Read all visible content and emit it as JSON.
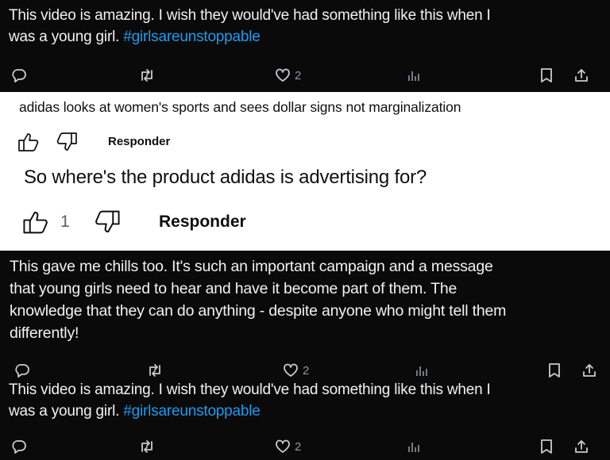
{
  "tweet1": {
    "line1": "This video is amazing. I wish they would've had something like this when I",
    "line2_prefix": "was a young girl. ",
    "hashtag": "#girlsareunstoppable",
    "likes": "2"
  },
  "comment1": {
    "text": "adidas looks at women's sports and sees dollar signs not marginalization",
    "reply_label": "Responder"
  },
  "comment2": {
    "text": "So where's the product adidas is advertising for?",
    "likes": "1",
    "reply_label": "Responder"
  },
  "tweet2": {
    "lines": [
      "This gave me chills too. It's such an important campaign and a message",
      "that young girls need to hear and have it become part of them. The",
      "knowledge that they can do anything - despite anyone who might tell them",
      "differently!"
    ],
    "likes": "2"
  },
  "tweet3": {
    "line1": "This video is amazing. I wish they would've had something like this when I",
    "line2_prefix": "was a young girl. ",
    "hashtag": "#girlsareunstoppable",
    "likes": "2"
  },
  "colors": {
    "dark_bg": "#0a0a0a",
    "hashtag": "#1d9bf0",
    "icon_gray": "#8b98a5"
  },
  "icons": [
    "reply-icon",
    "retweet-icon",
    "heart-icon",
    "views-icon",
    "bookmark-icon",
    "share-icon",
    "thumbs-up-icon",
    "thumbs-down-icon"
  ]
}
